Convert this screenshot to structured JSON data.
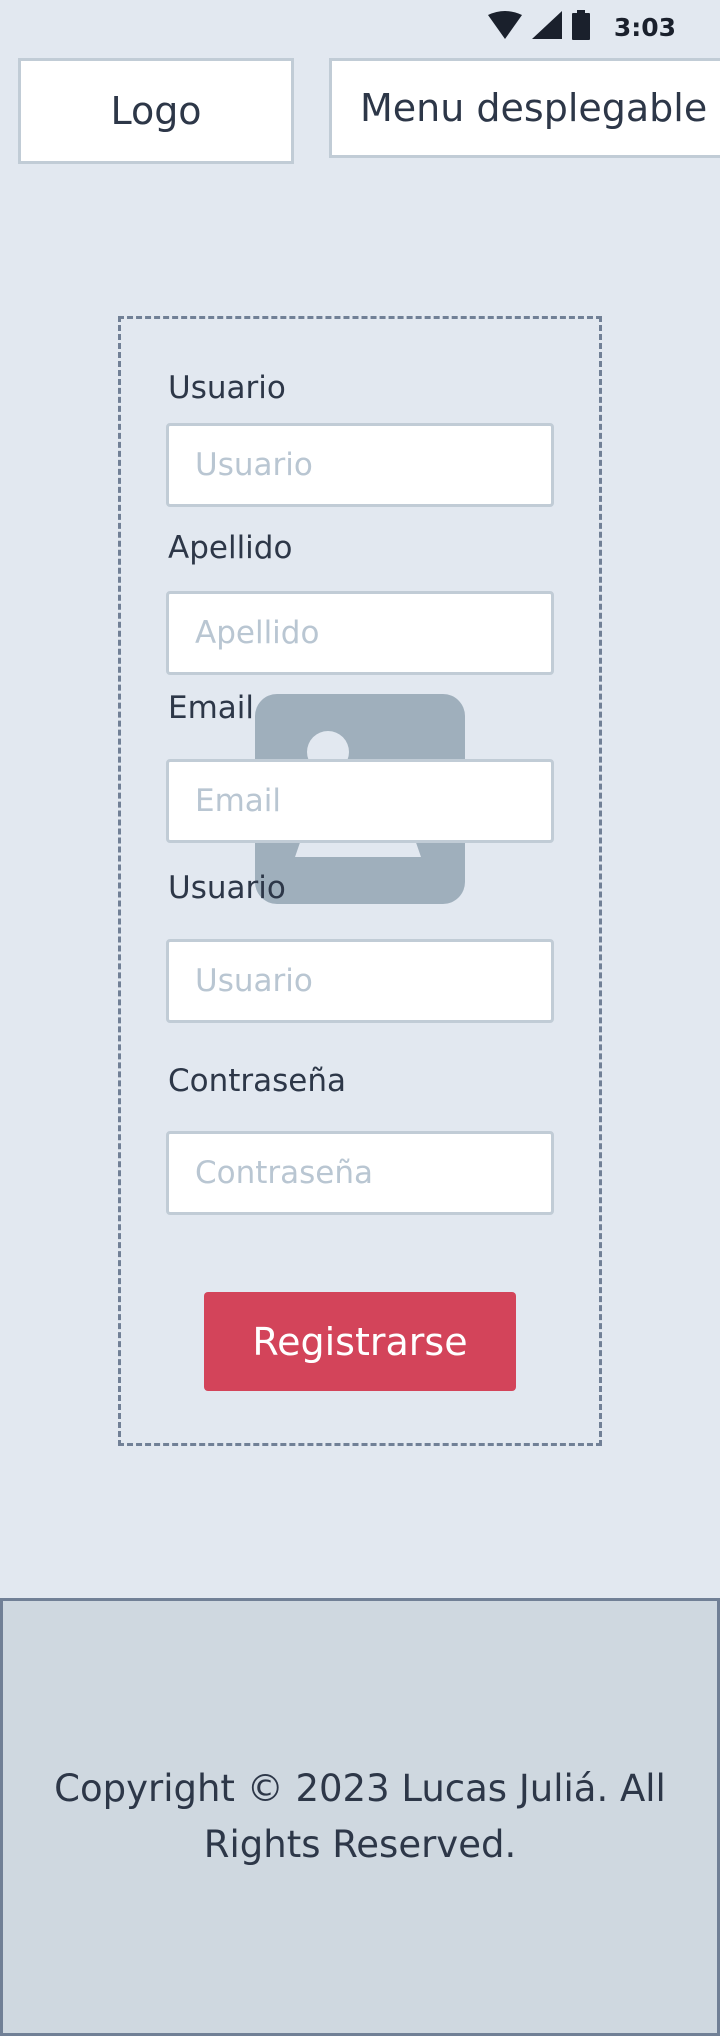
{
  "status_bar": {
    "time": "3:03",
    "icons": [
      "wifi-icon",
      "signal-icon",
      "battery-icon"
    ]
  },
  "header": {
    "logo_label": "Logo",
    "menu_label": "Menu desplegable"
  },
  "form": {
    "fields": [
      {
        "label": "Usuario",
        "placeholder": "Usuario"
      },
      {
        "label": "Apellido",
        "placeholder": "Apellido"
      },
      {
        "label": "Email",
        "placeholder": "Email"
      },
      {
        "label": "Usuario",
        "placeholder": "Usuario"
      },
      {
        "label": "Contraseña",
        "placeholder": "Contraseña"
      }
    ],
    "submit_label": "Registrarse"
  },
  "footer": {
    "copyright": "Copyright © 2023 Lucas Juliá. All Rights Reserved."
  },
  "colors": {
    "background": "#e2e8f0",
    "accent": "#d3445a",
    "placeholder_image": "#9fafbc",
    "footer_bg": "#cfd8e0"
  }
}
